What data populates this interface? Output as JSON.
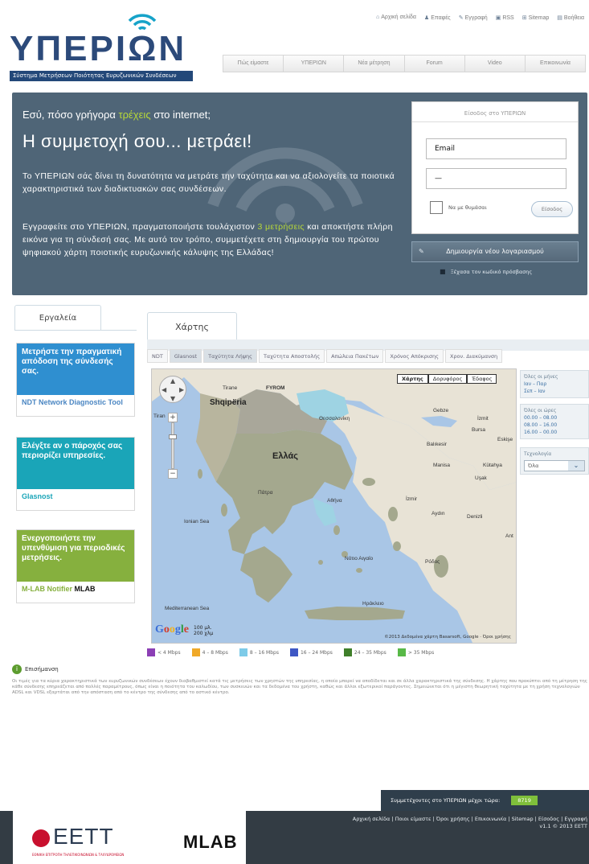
{
  "logo": {
    "text": "ΥΠΕΡΙΩΝ",
    "subtitle": "Σύστημα Μετρήσεων Ποιότητας Ευρυζωνικών Συνδέσεων"
  },
  "toplinks": [
    "Αρχική σελίδα",
    "Επαφές",
    "Εγγραφή",
    "RSS",
    "Sitemap",
    "Βοήθεια"
  ],
  "nav": [
    "Πώς είμαστε",
    "ΥΠΕΡΙΩΝ",
    "Νέα μέτρηση",
    "Forum",
    "Video",
    "Επικοινωνία"
  ],
  "hero": {
    "question_pre": "Εσύ, πόσο γρήγορα ",
    "question_hl": "τρέχεις",
    "question_post": " στο internet;",
    "headline": "Η συμμετοχή σου... μετράει!",
    "p1": "Το ΥΠΕΡΙΩΝ σάς δίνει τη δυνατότητα να μετράτε την ταχύτητα και να αξιολογείτε τα ποιοτικά χαρακτηριστικά των διαδικτυακών σας συνδέσεων.",
    "p2_pre": "Εγγραφείτε στο ΥΠΕΡΙΩΝ, πραγματοποιήστε τουλάχιστον ",
    "p2_hl": "3 μετρήσεις",
    "p2_post": " και αποκτήστε πλήρη εικόνα για τη σύνδεσή σας. Με αυτό τον τρόπο, συμμετέχετε στη δημιουργία του πρώτου ψηφιακού χάρτη ποιοτικής ευρυζωνικής κάλυψης της Ελλάδας!"
  },
  "login": {
    "title": "Είσοδος στο ΥΠΕΡΙΩΝ",
    "email_value": "Email",
    "password_value": "—",
    "remember": "Να με θυμάσαι",
    "submit": "Είσοδος",
    "create": "Δημιουργία νέου λογαριασμού",
    "forgot": "Ξέχασα τον κωδικό πρόσβασης"
  },
  "tools": {
    "tab": "Εργαλεία",
    "items": [
      {
        "head": "Μετρήστε την πραγματική απόδοση της σύνδεσής σας.",
        "foot": "NDT Network Diagnostic Tool",
        "color": "#2f8fd0",
        "footcolor": "#4b86c2"
      },
      {
        "head": "Ελέγξτε αν ο πάροχός σας περιορίζει υπηρεσίες.",
        "foot": "Glasnost",
        "color": "#1aa5b8",
        "footcolor": "#1aa5b8"
      },
      {
        "head": "Ενεργοποιήστε την υπενθύμιση για περιοδικές μετρήσεις.",
        "foot": "M-LAB Notifier",
        "foot2": "MLAB",
        "color": "#86b03e",
        "footcolor": "#86b03e"
      }
    ]
  },
  "map": {
    "tab": "Χάρτης",
    "filters": [
      "NDT",
      "Glasnost",
      "Ταχύτητα Λήψης",
      "Ταχύτητα Αποστολής",
      "Απώλεια Πακέτων",
      "Χρόνος Απόκρισης",
      "Χρον. Διακύμανση"
    ],
    "active_filters": [
      1,
      2
    ],
    "types": [
      "Χάρτης",
      "Δορυφόρος",
      "Έδαφος"
    ],
    "labels": {
      "greece": "Ελλάς",
      "albania": "Shqipëria",
      "fyrom": "FYROM",
      "tirane": "Tirane",
      "thessaloniki": "Θεσσαλονίκη",
      "izmir": "İzmir",
      "bursa": "Bursa",
      "balikesir": "Balıkesir",
      "gebze": "Gebze",
      "izmit": "İzmit",
      "eskisehir": "Eskişe",
      "kutahya": "Kütahya",
      "usak": "Uşak",
      "manisa": "Manisa",
      "aydin": "Aydın",
      "denizli": "Denizli",
      "ant": "Ant",
      "patra": "Πάτρα",
      "athens": "Αθήνα",
      "rodos": "Ρόδος",
      "hrakleio": "Ηράκλειο",
      "ionian": "Ionian Sea",
      "aegean": "Νότιο Αιγαίο",
      "medsea": "Mediterranean Sea",
      "tiran": "Tiran"
    },
    "google": "Google",
    "scale_km": "100 μλ.",
    "scale_mi": "200 χλμ",
    "copyright": "©2013 Δεδομένα χάρτη Basarsoft, Google · Όροι χρήσης"
  },
  "side": {
    "months_title": "Όλες οι μήνες",
    "months": [
      "Ιαν – Παρ",
      "Σεπ – Ιαν"
    ],
    "hours_title": "Όλες οι ώρες",
    "hours": [
      "00.00 – 08.00",
      "08.00 – 16.00",
      "16.00 – 00.00"
    ],
    "tech_title": "Τεχνολογία",
    "tech_value": "Όλα"
  },
  "legend": [
    {
      "label": "< 4 Mbps",
      "color": "#8c3fb5"
    },
    {
      "label": "4 – 8 Mbps",
      "color": "#f0a928"
    },
    {
      "label": "8 – 16 Mbps",
      "color": "#7ecbe8"
    },
    {
      "label": "16 – 24 Mbps",
      "color": "#3e57c4"
    },
    {
      "label": "24 – 35 Mbps",
      "color": "#3f7f2a"
    },
    {
      "label": "> 35 Mbps",
      "color": "#58b947"
    }
  ],
  "notes": {
    "title": "Επισήμανση",
    "text": "Οι τιμές για τα κύρια χαρακτηριστικά των ευρυζωνικών συνδέσεων έχουν διαβαθμιστεί κατά τις μετρήσεις των χρηστών της υπηρεσίας, η οποία μπορεί να αποδίδεται και σε άλλα χαρακτηριστικά της σύνδεσης. Η χάρτης που προκύπτει από τη μέτρηση της κάθε σύνδεσης επηρεάζεται από πολλές παραμέτρους, όπως είναι η ποιότητα του καλωδίου, των συσκευών και τα δεδομένα του χρήστη, καθώς και άλλοι εξωτερικοί παράγοντες. Σημειώνεται ότι η μέγιστη θεωρητική ταχύτητα με τη χρήση τεχνολογιών ADSL και VDSL εξαρτάται από την απόσταση από το κέντρο της σύνδεσης από το αστικό κέντρο."
  },
  "footer": {
    "stats_label": "Συμμετέχοντες στο ΥΠΕΡΙΩΝ μέχρι τώρα:",
    "stats_value": "8719",
    "eett": "EETT",
    "eett_sub": "ΕΘΝΙΚΗ ΕΠΙΤΡΟΠΗ ΤΗΛΕΠΙΚΟΙΝΩΝΙΩΝ & ΤΑΧΥΔΡΟΜΕΙΩΝ",
    "mlab": "MLAB",
    "links": "Αρχική σελίδα | Ποιοι είμαστε | Όροι χρήσης | Επικοινωνία | Sitemap | Είσοδος | Εγγραφή",
    "version": "v1.1 © 2013 ΕΕΤΤ"
  }
}
